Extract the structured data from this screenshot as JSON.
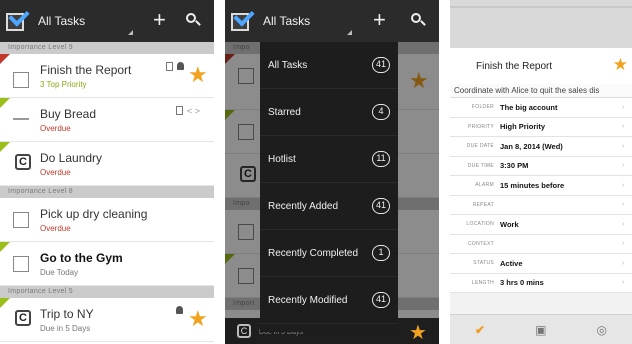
{
  "screen1": {
    "title": "All Tasks",
    "sections": [
      {
        "header": "Importance Level 9",
        "rows": [
          {
            "title": "Finish the Report",
            "subtitle": "3 Top Priority",
            "sub_color": "green"
          },
          {
            "title": "Buy Bread",
            "subtitle": "Overdue",
            "sub_color": "red"
          },
          {
            "title": "Do Laundry",
            "subtitle": "Overdue",
            "sub_color": "red"
          }
        ]
      },
      {
        "header": "Importance Level 8",
        "rows": [
          {
            "title": "Pick up dry cleaning",
            "subtitle": "Overdue",
            "sub_color": "red"
          },
          {
            "title": "Go to the Gym",
            "subtitle": "Due Today",
            "sub_color": "gray"
          }
        ]
      },
      {
        "header": "Importance Level 5",
        "rows": [
          {
            "title": "Trip to NY",
            "subtitle": "Due in 5 Days",
            "sub_color": "gray"
          }
        ]
      }
    ],
    "tags_glyph": "< >"
  },
  "screen2": {
    "title": "All Tasks",
    "background_sections": [
      "Impo",
      "Impo",
      "Import"
    ],
    "menu": [
      {
        "label": "All Tasks",
        "count": "41"
      },
      {
        "label": "Starred",
        "count": "4"
      },
      {
        "label": "Hotlist",
        "count": "11"
      },
      {
        "label": "Recently Added",
        "count": "41"
      },
      {
        "label": "Recently Completed",
        "count": "1"
      },
      {
        "label": "Recently Modified",
        "count": "41"
      }
    ],
    "bottom_text": "Due in 5 Days"
  },
  "screen3": {
    "task_title": "Finish the Report",
    "note": "Coordinate with Alice to quit the sales dis",
    "fields": [
      {
        "label": "Folder",
        "value": "The big account"
      },
      {
        "label": "Priority",
        "value": "High Priority"
      },
      {
        "label": "Due Date",
        "value": "Jan 8, 2014 (Wed)"
      },
      {
        "label": "Due Time",
        "value": "3:30 PM"
      },
      {
        "label": "Alarm",
        "value": "15 minutes before"
      },
      {
        "label": "Repeat",
        "value": ""
      },
      {
        "label": "Location",
        "value": "Work"
      },
      {
        "label": "Context",
        "value": ""
      },
      {
        "label": "Status",
        "value": "Active"
      },
      {
        "label": "Length",
        "value": "3 hrs 0 mins"
      }
    ]
  },
  "colors": {
    "actionbar": "#2b2b2b",
    "accent_blue": "#4da6ff",
    "star": "#f2a21f",
    "priority_green": "#9bbf1a",
    "overdue_red": "#c0392b"
  },
  "icons": {
    "star": "★",
    "plus": "+",
    "arrow": "›",
    "check": "✔",
    "recur": "C"
  }
}
